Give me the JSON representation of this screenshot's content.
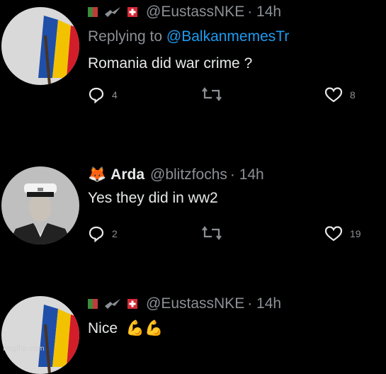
{
  "tweets": [
    {
      "handle": "@EustassNKE",
      "time": "· 14h",
      "replying_prefix": "Replying to ",
      "replying_to": "@BalkanmemesTr",
      "text": "Romania did war crime ?",
      "actions": {
        "replies": "4",
        "likes": "8"
      }
    },
    {
      "emoji": "🦊",
      "name": "Arda",
      "handle": "@blitzfochs",
      "time": "· 14h",
      "text": "Yes they did in ww2",
      "actions": {
        "replies": "2",
        "likes": "19"
      }
    },
    {
      "handle": "@EustassNKE",
      "time": "· 14h",
      "text": "Nice",
      "emoji": "💪💪"
    }
  ],
  "watermark": "imgflip.com",
  "colors": {
    "background": "#000000",
    "text": "#e7e9ea",
    "muted": "#8b9096",
    "mention": "#1d9bf0",
    "flag_blue": "#1f4fa8",
    "flag_yellow": "#f2c200",
    "flag_red": "#d21d2a"
  },
  "icons": [
    "reply-icon",
    "retweet-icon",
    "like-icon"
  ]
}
